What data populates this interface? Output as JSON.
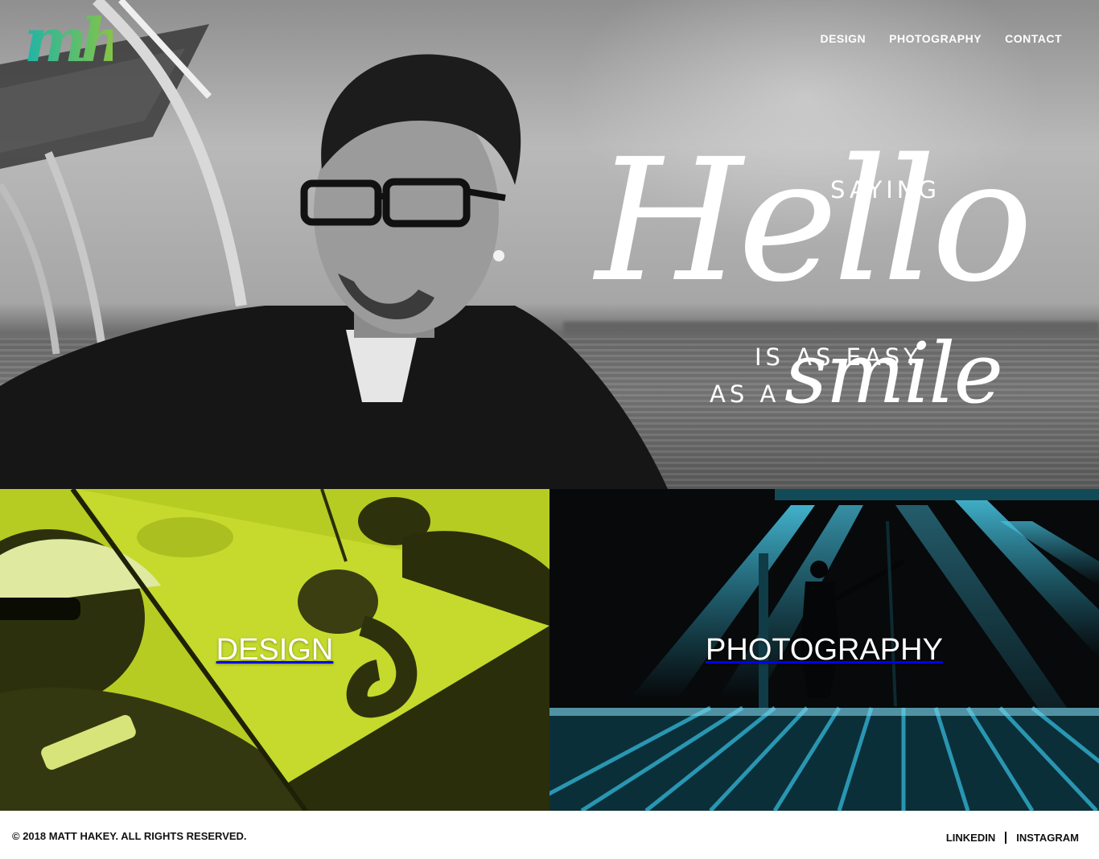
{
  "brand": {
    "logo_text": "mh",
    "logo_color_from": "#1fb3a8",
    "logo_color_to": "#8cc63f"
  },
  "nav": {
    "items": [
      {
        "label": "DESIGN"
      },
      {
        "label": "PHOTOGRAPHY"
      },
      {
        "label": "CONTACT"
      }
    ]
  },
  "hero": {
    "tagline": {
      "saying": "SAYING",
      "hello": "Hello",
      "is_as_easy": "IS AS EASY",
      "as_a": "AS A",
      "smile": "smile"
    }
  },
  "tiles": {
    "design": {
      "label": "DESIGN",
      "tint": "#c2d62a"
    },
    "photography": {
      "label": "PHOTOGRAPHY",
      "tint": "#29a6c3"
    }
  },
  "footer": {
    "copyright": "© 2018 MATT HAKEY. ALL RIGHTS RESERVED.",
    "links": [
      {
        "label": "LINKEDIN"
      },
      {
        "label": "INSTAGRAM"
      }
    ]
  }
}
